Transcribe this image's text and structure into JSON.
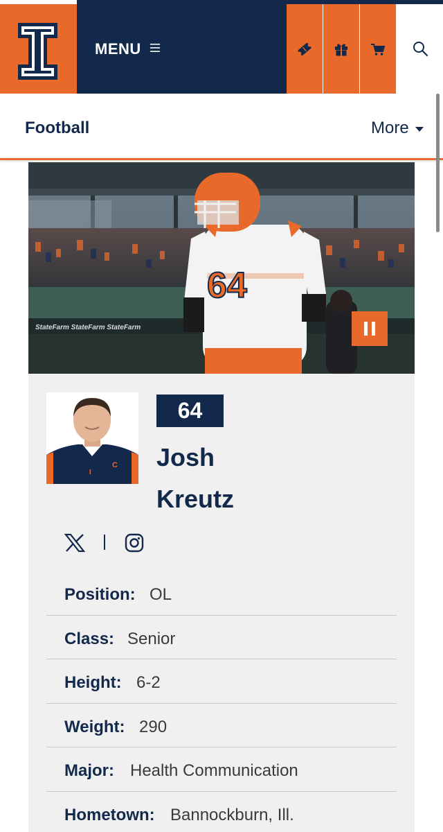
{
  "header": {
    "menu_label": "MENU",
    "logo_icon": "block-i-logo-icon",
    "buttons": [
      {
        "name": "tickets",
        "icon": "ticket-icon"
      },
      {
        "name": "gift",
        "icon": "gift-icon"
      },
      {
        "name": "cart",
        "icon": "cart-icon"
      },
      {
        "name": "search",
        "icon": "search-icon"
      }
    ]
  },
  "sportbar": {
    "title": "Football",
    "more_label": "More"
  },
  "hero": {
    "pause_icon": "pause-icon"
  },
  "player": {
    "jersey_number": "64",
    "first_name": "Josh",
    "last_name": "Kreutz",
    "social": [
      "x-icon",
      "instagram-icon"
    ],
    "bio": [
      {
        "label": "Position:",
        "value": "OL"
      },
      {
        "label": "Class:",
        "value": "Senior"
      },
      {
        "label": "Height:",
        "value": "6-2"
      },
      {
        "label": "Weight:",
        "value": "290"
      },
      {
        "label": "Major:",
        "value": "Health Communication"
      },
      {
        "label": "Hometown:",
        "value": "Bannockburn, Ill."
      }
    ]
  },
  "colors": {
    "orange": "#e8692a",
    "navy": "#13294b",
    "panel": "#f0f0f0"
  }
}
